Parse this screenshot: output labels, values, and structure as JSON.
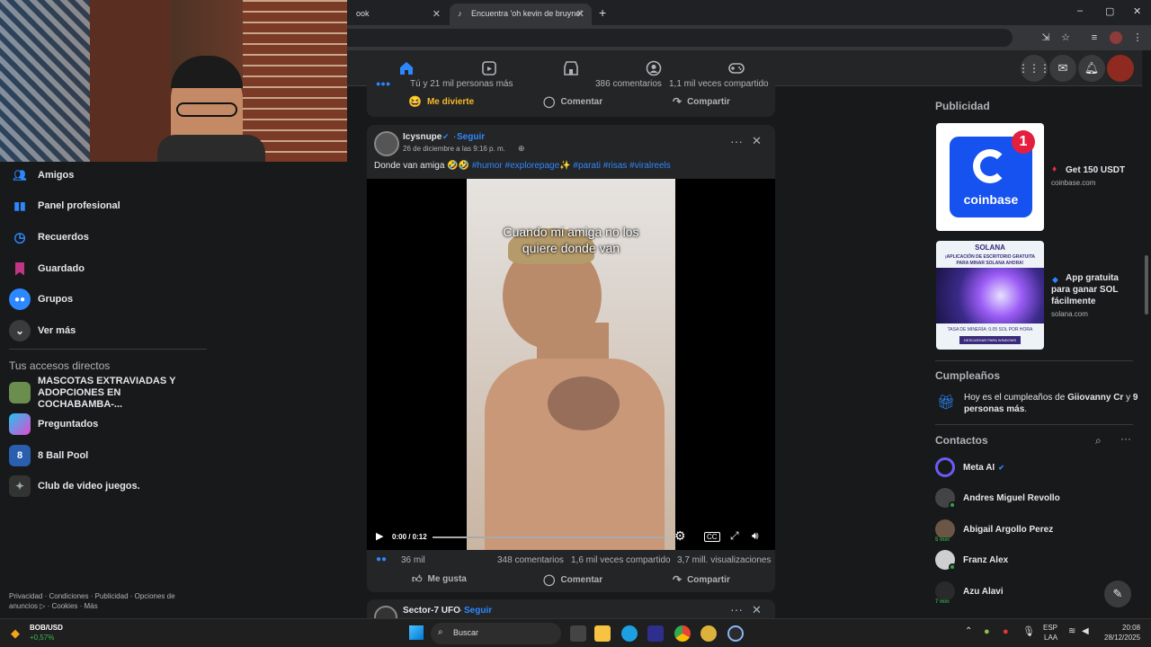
{
  "browser": {
    "tabs": [
      {
        "title": "ook"
      },
      {
        "title": "Encuentra 'oh kevin de bruyne'"
      }
    ],
    "new_tab": "+",
    "window_controls": [
      "–",
      "▢",
      "✕"
    ]
  },
  "colors": {
    "accent": "#2d88ff",
    "bg": "#18191a",
    "card": "#242526",
    "online": "#31a24c"
  },
  "sidebar": {
    "items": [
      {
        "label": "Amigos",
        "icon": "friends-icon"
      },
      {
        "label": "Panel profesional",
        "icon": "dashboard-icon"
      },
      {
        "label": "Recuerdos",
        "icon": "clock-icon"
      },
      {
        "label": "Guardado",
        "icon": "bookmark-icon"
      },
      {
        "label": "Grupos",
        "icon": "groups-icon"
      },
      {
        "label": "Ver más",
        "icon": "chevron-down-icon"
      }
    ],
    "shortcuts_title": "Tus accesos directos",
    "shortcuts": [
      {
        "label": "MASCOTAS EXTRAVIADAS Y ADOPCIONES EN COCHABAMBA-..."
      },
      {
        "label": "Preguntados"
      },
      {
        "label": "8 Ball Pool"
      },
      {
        "label": "Club de video juegos."
      }
    ],
    "footer": "Privacidad · Condiciones · Publicidad · Opciones de anuncios ▷ · Cookies · Más"
  },
  "feed": {
    "prev_post": {
      "reactions": "Tú y 21 mil personas más",
      "comments": "386 comentarios",
      "shares": "1,1 mil veces compartido",
      "reaction_label": "Me divierte",
      "comment_label": "Comentar",
      "share_label": "Compartir"
    },
    "post": {
      "author": "Icysnupe",
      "follow": "Seguir",
      "date": "26 de diciembre a las 9:16 p. m.",
      "text": "Donde van amiga 🤣🤣",
      "hashtags": "#humor #explorepage✨ #parati #risas #viralreels",
      "video_caption": "Cuando mi amiga no los quiere donde van",
      "time": "0:00 / 0:12",
      "reactions": "36 mil",
      "comments": "348 comentarios",
      "shares": "1,6 mil veces compartido",
      "views": "3,7 mill. visualizaciones",
      "like_label": "Me gusta",
      "comment_label": "Comentar",
      "share_label": "Compartir"
    },
    "next_post": {
      "author": "Sector-7 UFO",
      "follow": "Seguir"
    }
  },
  "right": {
    "ads_title": "Publicidad",
    "ads": [
      {
        "badge": "1",
        "brand": "coinbase",
        "title": "Get 150 USDT",
        "domain": "coinbase.com"
      },
      {
        "brand": "SOLANA",
        "banner_text": "¡APLICACIÓN DE ESCRITORIO GRATUITA PARA MINAR SOLANA AHORA!",
        "rate": "TASA DE MINERÍA: 0.05 SOL POR HORA",
        "btn": "DESCARGAR PARA WINDOWS",
        "title": "App gratuita para ganar SOL fácilmente",
        "domain": "solana.com"
      }
    ],
    "birthdays_title": "Cumpleaños",
    "birthday_pre": "Hoy es el cumpleaños de ",
    "birthday_name": "Giiovanny Cr",
    "birthday_mid": " y ",
    "birthday_others": "9 personas más",
    "birthday_end": ".",
    "contacts_title": "Contactos",
    "contacts": [
      {
        "name": "Meta AI",
        "status": ""
      },
      {
        "name": "Andres Miguel Revollo",
        "status": "online"
      },
      {
        "name": "Abigail Argollo Perez",
        "status": "5 min"
      },
      {
        "name": "Franz Alex",
        "status": "online"
      },
      {
        "name": "Azu Alavi",
        "status": "7 min"
      }
    ]
  },
  "taskbar": {
    "ticker_name": "BOB/USD",
    "ticker_change": "+0,57%",
    "search": "Buscar",
    "lang": "ESP",
    "lang2": "LAA",
    "time": "20:08",
    "date": "28/12/2025"
  }
}
